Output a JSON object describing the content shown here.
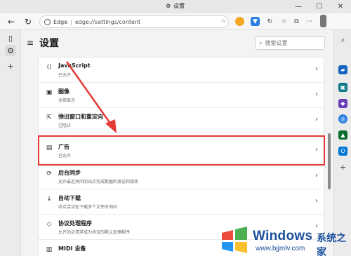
{
  "window": {
    "title": "设置",
    "controls": [
      "minimize",
      "maximize",
      "close"
    ]
  },
  "toolbar": {
    "address_prefix": "Edge",
    "url": "edge://settings/content"
  },
  "leftbar": {
    "items": [
      "tabs-icon",
      "settings-gear-icon",
      "add-icon"
    ]
  },
  "settings": {
    "title": "设置",
    "search_placeholder": "搜索设置"
  },
  "rows": [
    {
      "name": "javascript",
      "label": "JavaScript",
      "sub": "已允许",
      "icon": "code-icon"
    },
    {
      "name": "images",
      "label": "图像",
      "sub": "全部显示",
      "icon": "image-icon"
    },
    {
      "name": "popups",
      "label": "弹出窗口和重定向",
      "sub": "已阻止",
      "icon": "popup-icon"
    },
    {
      "name": "ads",
      "label": "广告",
      "sub": "已允许",
      "icon": "ads-icon"
    },
    {
      "name": "background-sync",
      "label": "后台同步",
      "sub": "允许最近关闭的站点完成数据的发送和接收",
      "icon": "sync-icon"
    },
    {
      "name": "auto-downloads",
      "label": "自动下载",
      "sub": "站点尝试在下载多个文件时询问",
      "icon": "download-icon"
    },
    {
      "name": "protocol-handlers",
      "label": "协议处理程序",
      "sub": "允许站点请求成为协议的默认处理程序",
      "icon": "protocol-icon"
    },
    {
      "name": "midi",
      "label": "MIDI 设备",
      "sub": "",
      "icon": "midi-icon"
    }
  ],
  "colors": {
    "highlight": "#e53935",
    "arrow": "#e53935",
    "watermark": "#1a4f9c"
  },
  "watermark": {
    "brand": "Windows",
    "cn": "系统之家",
    "url": "www.bjjmlv.com"
  }
}
